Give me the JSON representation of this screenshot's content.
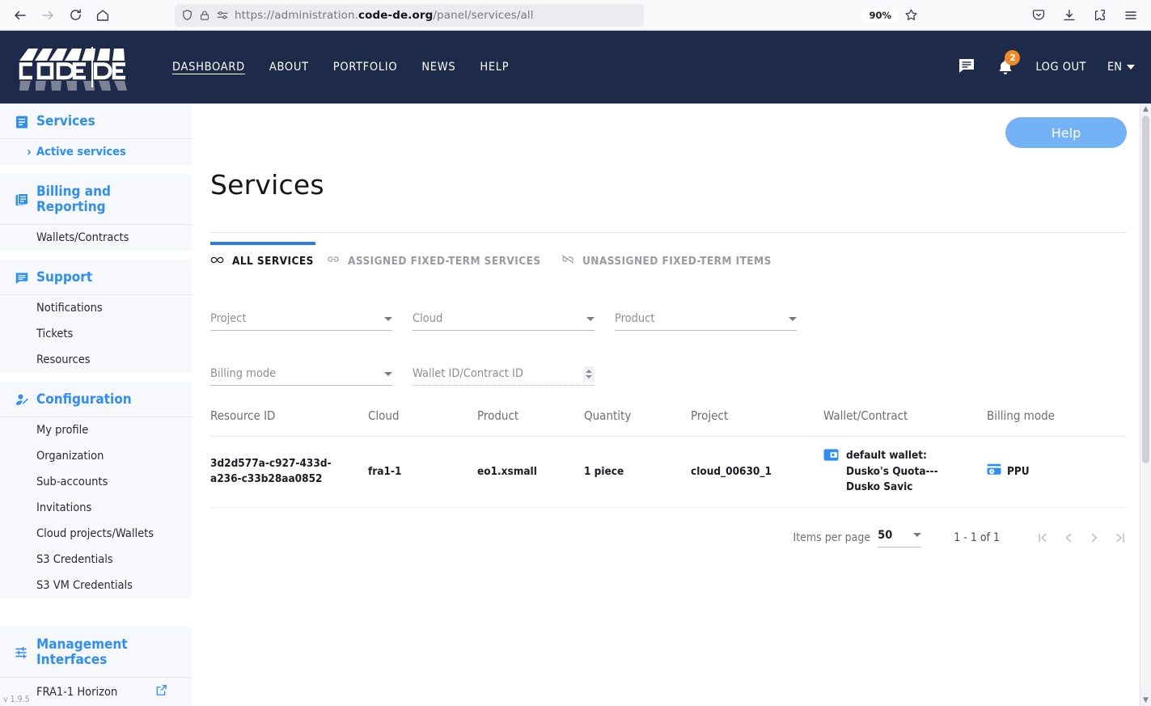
{
  "browser": {
    "url_prefix": "https://administration.",
    "url_domain": "code-de.org",
    "url_suffix": "/panel/services/all",
    "zoom": "90%"
  },
  "navbar": {
    "logo_text": "CODE|DE",
    "links": [
      {
        "label": "DASHBOARD",
        "active": true
      },
      {
        "label": "ABOUT",
        "active": false
      },
      {
        "label": "PORTFOLIO",
        "active": false
      },
      {
        "label": "NEWS",
        "active": false
      },
      {
        "label": "HELP",
        "active": false
      }
    ],
    "notification_count": "2",
    "logout_label": "LOG OUT",
    "language": "EN"
  },
  "sidebar": {
    "groups": [
      {
        "title": "Services",
        "icon": "list-document-icon",
        "items": [
          {
            "label": "Active services",
            "active": true
          }
        ]
      },
      {
        "title": "Billing and Reporting",
        "icon": "stacked-documents-icon",
        "items": [
          {
            "label": "Wallets/Contracts",
            "active": false
          }
        ]
      },
      {
        "title": "Support",
        "icon": "speech-bubble-icon",
        "items": [
          {
            "label": "Notifications",
            "active": false
          },
          {
            "label": "Tickets",
            "active": false
          },
          {
            "label": "Resources",
            "active": false
          }
        ]
      },
      {
        "title": "Configuration",
        "icon": "person-edit-icon",
        "items": [
          {
            "label": "My profile",
            "active": false
          },
          {
            "label": "Organization",
            "active": false
          },
          {
            "label": "Sub-accounts",
            "active": false
          },
          {
            "label": "Invitations",
            "active": false
          },
          {
            "label": "Cloud projects/Wallets",
            "active": false
          },
          {
            "label": "S3 Credentials",
            "active": false
          },
          {
            "label": "S3 VM Credentials",
            "active": false
          }
        ]
      }
    ],
    "management": {
      "title": "Management Interfaces",
      "icon": "sliders-icon",
      "items": [
        {
          "label": "FRA1-1 Horizon",
          "external": true
        }
      ]
    },
    "version": "v 1.9.5"
  },
  "main": {
    "help_button": "Help",
    "page_title": "Services",
    "tabs": [
      {
        "label": "ALL SERVICES",
        "icon": "infinity-icon",
        "active": true
      },
      {
        "label": "ASSIGNED FIXED-TERM SERVICES",
        "icon": "link-icon",
        "active": false
      },
      {
        "label": "UNASSIGNED FIXED-TERM ITEMS",
        "icon": "broken-link-icon",
        "active": false
      }
    ],
    "filters": [
      {
        "name": "project",
        "placeholder": "Project",
        "value": "",
        "control": "select"
      },
      {
        "name": "cloud",
        "placeholder": "Cloud",
        "value": "",
        "control": "select"
      },
      {
        "name": "product",
        "placeholder": "Product",
        "value": "",
        "control": "select"
      },
      {
        "name": "billing-mode",
        "placeholder": "Billing mode",
        "value": "",
        "control": "select"
      },
      {
        "name": "wallet-id",
        "placeholder": "Wallet ID/Contract ID",
        "value": "",
        "control": "number"
      }
    ],
    "table": {
      "columns": [
        "Resource ID",
        "Cloud",
        "Product",
        "Quantity",
        "Project",
        "Wallet/Contract",
        "Billing mode"
      ],
      "rows": [
        {
          "resource_id": "3d2d577a-c927-433d-a236-c33b28aa0852",
          "cloud": "fra1-1",
          "product": "eo1.xsmall",
          "quantity": "1 piece",
          "project": "cloud_00630_1",
          "wallet": "default wallet: Dusko's Quota---Dusko Savic",
          "wallet_icon": "wallet-icon",
          "billing_mode": "PPU",
          "billing_icon": "ppu-card-icon"
        }
      ]
    },
    "pagination": {
      "items_per_page_label": "Items per page",
      "items_per_page_value": "50",
      "range": "1 - 1 of 1"
    }
  }
}
